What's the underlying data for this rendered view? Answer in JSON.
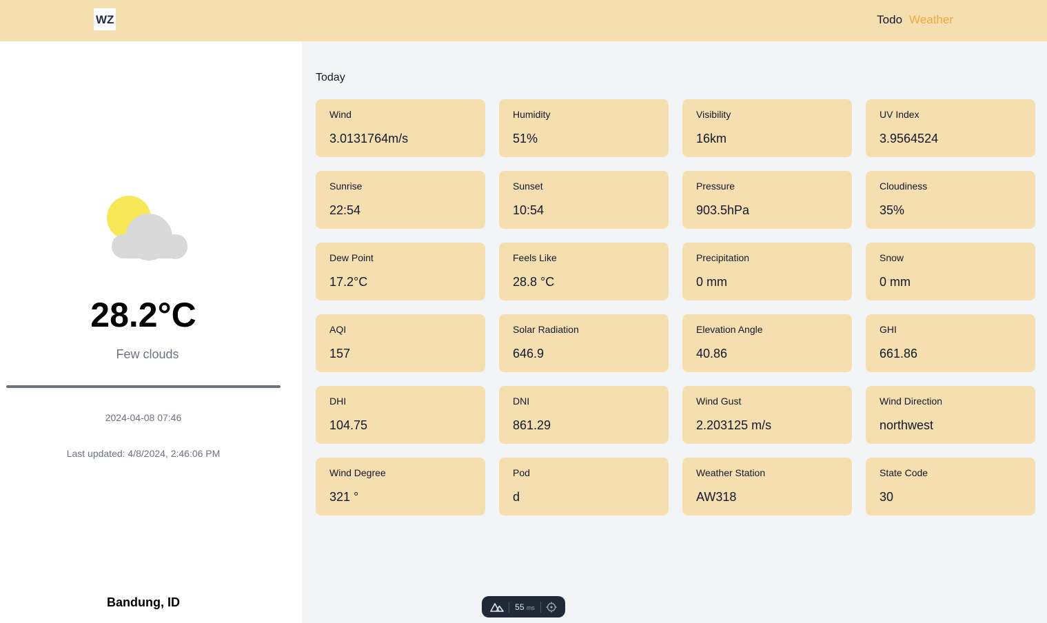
{
  "header": {
    "logo_text": "WZ",
    "nav": {
      "todo": "Todo",
      "weather": "Weather"
    }
  },
  "current": {
    "icon": "sun-behind-cloud-icon",
    "temperature": "28.2°C",
    "description": "Few clouds",
    "datetime": "2024-04-08 07:46",
    "last_updated": "Last updated: 4/8/2024, 2:46:06 PM",
    "location": "Bandung, ID"
  },
  "today": {
    "heading": "Today",
    "cards": [
      {
        "label": "Wind",
        "value": "3.0131764m/s"
      },
      {
        "label": "Humidity",
        "value": "51%"
      },
      {
        "label": "Visibility",
        "value": "16km"
      },
      {
        "label": "UV Index",
        "value": "3.9564524"
      },
      {
        "label": "Sunrise",
        "value": "22:54"
      },
      {
        "label": "Sunset",
        "value": "10:54"
      },
      {
        "label": "Pressure",
        "value": "903.5hPa"
      },
      {
        "label": "Cloudiness",
        "value": "35%"
      },
      {
        "label": "Dew Point",
        "value": "17.2°C"
      },
      {
        "label": "Feels Like",
        "value": "28.8 °C"
      },
      {
        "label": "Precipitation",
        "value": "0 mm"
      },
      {
        "label": "Snow",
        "value": "0 mm"
      },
      {
        "label": "AQI",
        "value": "157"
      },
      {
        "label": "Solar Radiation",
        "value": "646.9"
      },
      {
        "label": "Elevation Angle",
        "value": "40.86"
      },
      {
        "label": "GHI",
        "value": "661.86"
      },
      {
        "label": "DHI",
        "value": "104.75"
      },
      {
        "label": "DNI",
        "value": "861.29"
      },
      {
        "label": "Wind Gust",
        "value": "2.203125 m/s"
      },
      {
        "label": "Wind Direction",
        "value": "northwest"
      },
      {
        "label": "Wind Degree",
        "value": "321 °"
      },
      {
        "label": "Pod",
        "value": "d"
      },
      {
        "label": "Weather Station",
        "value": "AW318"
      },
      {
        "label": "State Code",
        "value": "30"
      }
    ]
  },
  "devtools": {
    "render_time": "55",
    "unit": "ms"
  },
  "colors": {
    "accent": "#f5deb0",
    "nav_active": "#f2a93b",
    "panel_bg": "#f3f4f6",
    "sun": "#f7e857",
    "cloud": "#d9d9d9"
  }
}
